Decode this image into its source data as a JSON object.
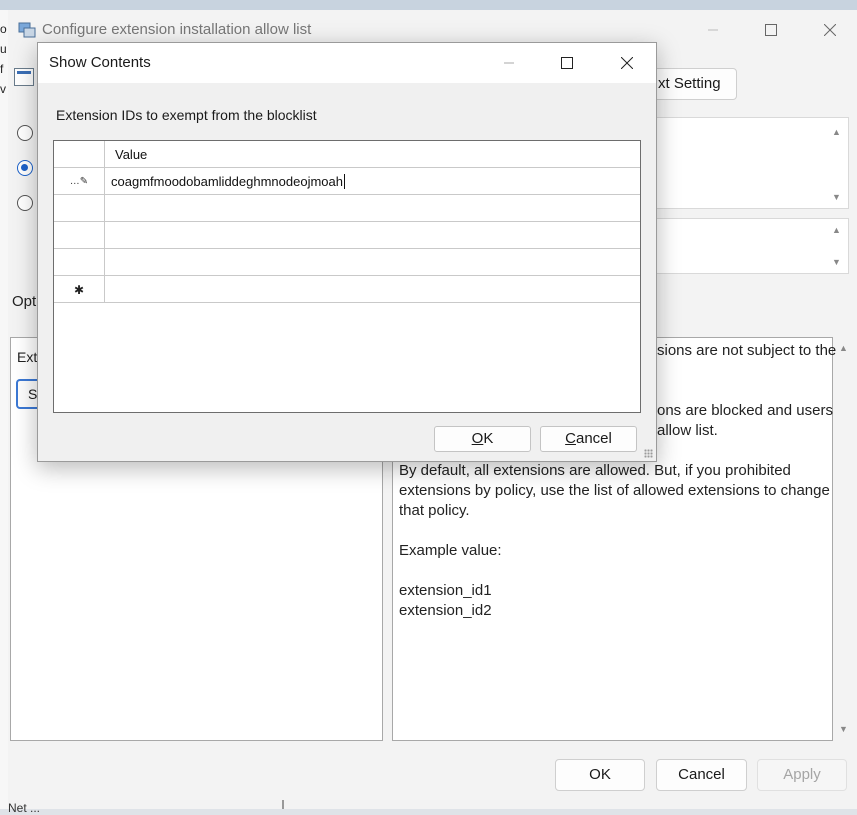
{
  "background_window": {
    "title": "Configure extension installation allow list",
    "next_setting_label": "xt Setting",
    "options_label": "Opt",
    "options_extension_label": "Ext",
    "show_button_label": "Sl",
    "left_edge_letters": [
      "o",
      "u",
      "f",
      "v"
    ],
    "help_fragments": [
      "sions are not subject to the",
      "ons are blocked and users",
      "allow list."
    ],
    "help_lines": [
      "By default, all extensions are allowed. But, if you prohibited",
      "extensions by policy, use the list of allowed extensions to change",
      "that policy.",
      "Example value:",
      "extension_id1",
      "extension_id2"
    ],
    "buttons": {
      "ok": "OK",
      "cancel": "Cancel",
      "apply": "Apply"
    },
    "status_text": "Net  ..."
  },
  "dialog": {
    "title": "Show Contents",
    "label": "Extension IDs to exempt from the blocklist",
    "column_header": "Value",
    "rows": [
      {
        "value": "coagmfmoodobamliddeghmnodeojmoah",
        "row_icon": "pencil-icon"
      },
      {
        "value": ""
      },
      {
        "value": ""
      },
      {
        "value": ""
      },
      {
        "value": "",
        "row_icon": "new-row-star-icon"
      }
    ],
    "ok_label": "OK",
    "ok_underline": "O",
    "ok_rest": "K",
    "cancel_label": "Cancel",
    "cancel_underline": "C",
    "cancel_rest": "ancel"
  }
}
